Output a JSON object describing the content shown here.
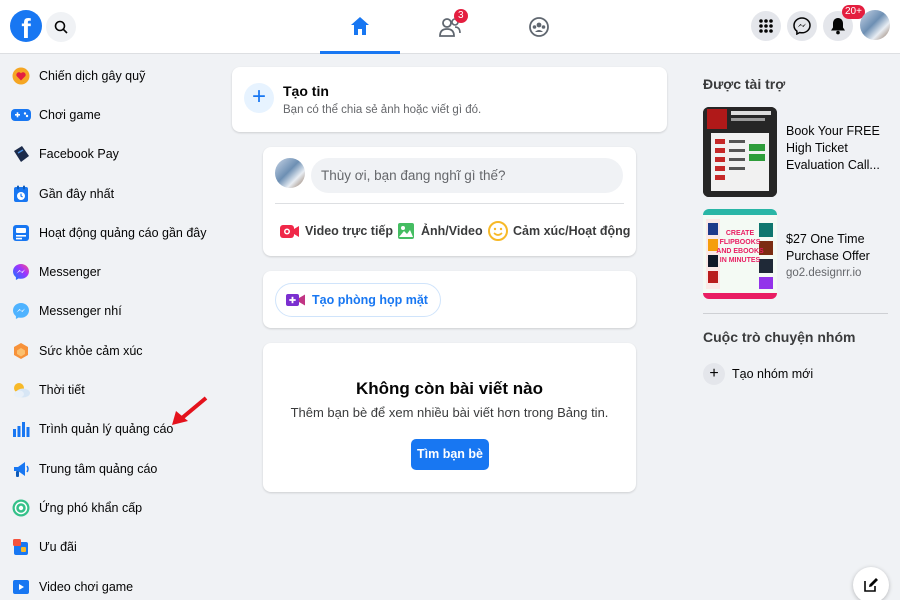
{
  "colors": {
    "brand": "#1877f2",
    "badge": "#e41e3f",
    "background": "#f0f2f5",
    "annotation_arrow": "#e4121c"
  },
  "header": {
    "logo": "f",
    "search_icon": "search-icon",
    "tabs": [
      {
        "name": "home",
        "icon": "home-icon",
        "active": true
      },
      {
        "name": "friends",
        "icon": "friends-icon",
        "badge": "3"
      },
      {
        "name": "groups",
        "icon": "groups-icon"
      }
    ],
    "right_buttons": [
      {
        "icon": "menu-grid-icon"
      },
      {
        "icon": "messenger-icon"
      },
      {
        "icon": "bell-icon",
        "badge": "20+"
      },
      {
        "icon": "profile-avatar"
      }
    ]
  },
  "sidebar": {
    "items": [
      {
        "label": "Chiến dịch gây quỹ",
        "icon": "fundraiser-icon"
      },
      {
        "label": "Chơi game",
        "icon": "gaming-icon"
      },
      {
        "label": "Facebook Pay",
        "icon": "pay-icon"
      },
      {
        "label": "Gần đây nhất",
        "icon": "recent-icon"
      },
      {
        "label": "Hoạt động quảng cáo gần đây",
        "icon": "recent-ad-activity-icon"
      },
      {
        "label": "Messenger",
        "icon": "messenger-icon"
      },
      {
        "label": "Messenger nhí",
        "icon": "messenger-kids-icon"
      },
      {
        "label": "Sức khỏe cảm xúc",
        "icon": "emotional-health-icon"
      },
      {
        "label": "Thời tiết",
        "icon": "weather-icon"
      },
      {
        "label": "Trình quản lý quảng cáo",
        "icon": "ads-manager-icon"
      },
      {
        "label": "Trung tâm quảng cáo",
        "icon": "ad-center-icon"
      },
      {
        "label": "Ứng phó khẩn cấp",
        "icon": "crisis-response-icon"
      },
      {
        "label": "Ưu đãi",
        "icon": "offers-icon"
      },
      {
        "label": "Video chơi game",
        "icon": "gaming-video-icon"
      }
    ]
  },
  "story": {
    "title": "Tạo tin",
    "subtitle": "Bạn có thể chia sẻ ảnh hoặc viết gì đó."
  },
  "composer": {
    "placeholder": "Thùy ơi, bạn đang nghĩ gì thế?",
    "actions": [
      {
        "label": "Video trực tiếp",
        "icon": "live-video-icon"
      },
      {
        "label": "Ảnh/Video",
        "icon": "photo-video-icon"
      },
      {
        "label": "Cảm xúc/Hoạt động",
        "icon": "feeling-activity-icon"
      }
    ]
  },
  "room": {
    "label": "Tạo phòng họp mặt"
  },
  "empty_feed": {
    "title": "Không còn bài viết nào",
    "subtitle": "Thêm bạn bè để xem nhiều bài viết hơn trong Bảng tin.",
    "button": "Tìm bạn bè"
  },
  "right_rail": {
    "sponsored_heading": "Được tài trợ",
    "ads": [
      {
        "title": "Book Your FREE High Ticket Evaluation Call...",
        "domain": ""
      },
      {
        "title": "$27 One Time Purchase Offer",
        "domain": "go2.designrr.io"
      }
    ],
    "ad2_image_text": "CREATE FLIPBOOKS AND EBOOKS IN MINUTES",
    "group_heading": "Cuộc trò chuyện nhóm",
    "new_group": "Tạo nhóm mới"
  }
}
